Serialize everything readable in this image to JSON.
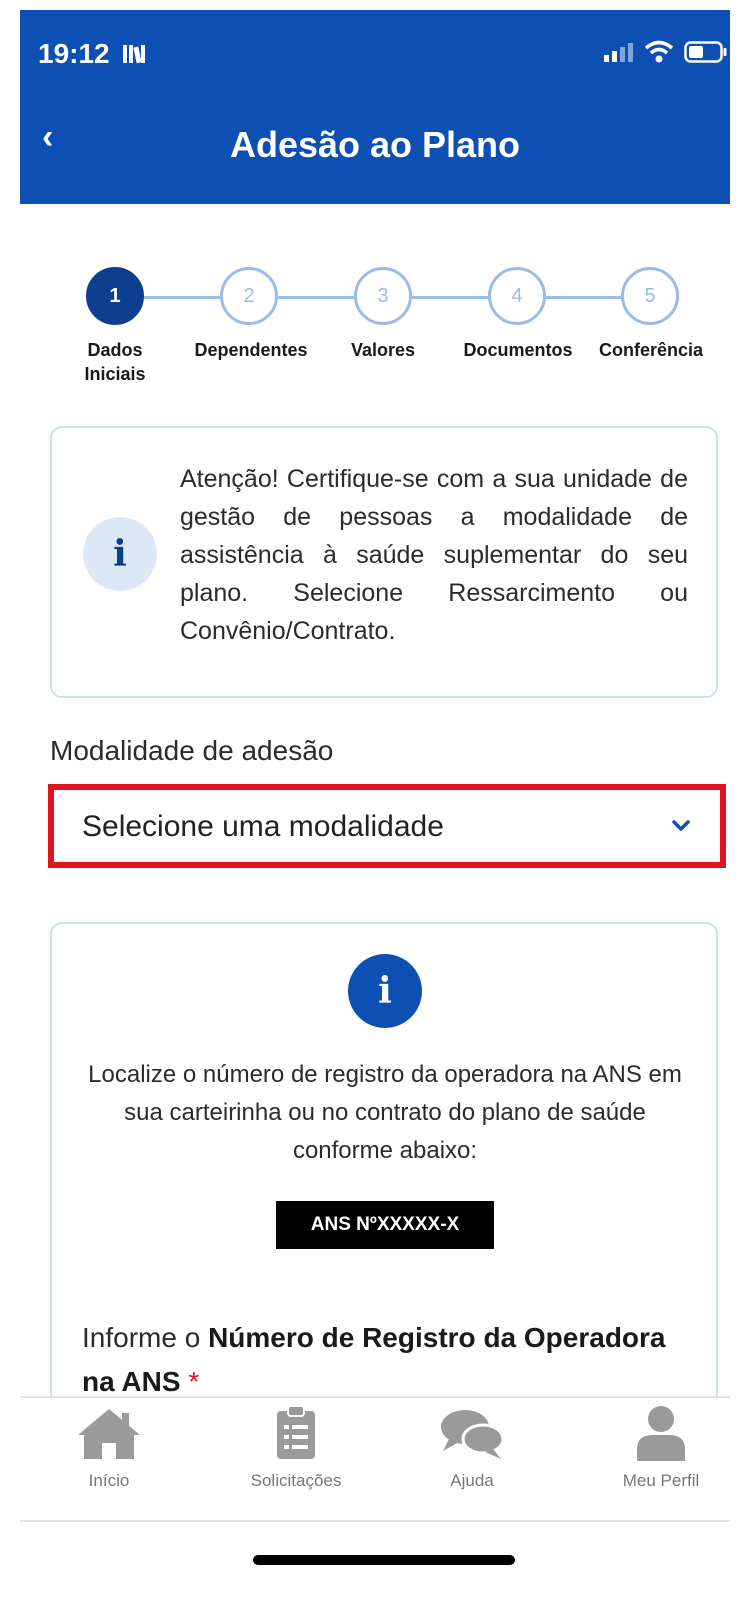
{
  "status_bar": {
    "time": "19:12"
  },
  "header": {
    "back_label": "‹",
    "title": "Adesão ao Plano"
  },
  "stepper": {
    "steps": [
      {
        "number": "1",
        "label_line1": "Dados",
        "label_line2": "Iniciais",
        "active": true
      },
      {
        "number": "2",
        "label_line1": "Dependentes",
        "label_line2": "",
        "active": false
      },
      {
        "number": "3",
        "label_line1": "Valores",
        "label_line2": "",
        "active": false
      },
      {
        "number": "4",
        "label_line1": "Documentos",
        "label_line2": "",
        "active": false
      },
      {
        "number": "5",
        "label_line1": "Conferência",
        "label_line2": "",
        "active": false
      }
    ]
  },
  "attention": {
    "icon": "info-icon",
    "text": "Atenção! Certifique-se com a sua unidade de gestão de pessoas a modalidade de assistência à saúde suplementar do seu plano. Selecione Ressarcimento ou Convênio/Contrato."
  },
  "modalidade": {
    "label": "Modalidade de adesão",
    "placeholder": "Selecione uma modalidade"
  },
  "ans_info": {
    "icon": "info-icon",
    "text": "Localize o número de registro da operadora na ANS em sua carteirinha ou no contrato do plano de saúde conforme abaixo:",
    "badge": "ANS NºXXXXX-X",
    "inform_prefix": "Informe o ",
    "inform_bold": "Número de Registro da Operadora na ANS",
    "required_mark": "*"
  },
  "bottom_nav": {
    "items": [
      {
        "label": "Início",
        "icon": "home-icon"
      },
      {
        "label": "Solicitações",
        "icon": "clipboard-icon"
      },
      {
        "label": "Ajuda",
        "icon": "chat-icon"
      },
      {
        "label": "Meu Perfil",
        "icon": "user-icon"
      }
    ]
  },
  "colors": {
    "brand": "#0d4fb3",
    "dark_blue": "#0d3f8f",
    "highlight": "#e0141c"
  }
}
